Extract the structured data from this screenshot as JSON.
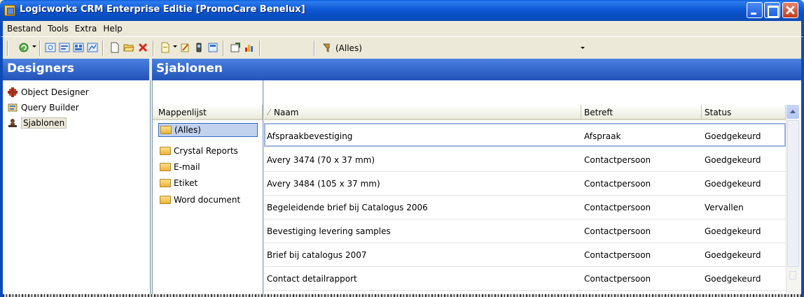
{
  "window": {
    "title": "Logicworks CRM Enterprise Editie  [PromoCare Benelux]"
  },
  "menu": [
    {
      "label": "Bestand"
    },
    {
      "label": "Tools"
    },
    {
      "label": "Extra"
    },
    {
      "label": "Help"
    }
  ],
  "toolbar": {
    "filter_value": "(Alles)",
    "icons": [
      "refresh-icon",
      "search-icon",
      "view-icon",
      "print-view-icon",
      "report-icon",
      "new-document-icon",
      "open-folder-icon",
      "delete-icon",
      "template-icon",
      "edit-icon",
      "mobile-icon",
      "calculator-icon",
      "export-icon",
      "chart-icon",
      "filter-icon"
    ]
  },
  "designers": {
    "header": "Designers",
    "items": [
      {
        "label": "Object Designer"
      },
      {
        "label": "Query Builder"
      },
      {
        "label": "Sjablonen"
      }
    ]
  },
  "sjablonen": {
    "header": "Sjablonen",
    "folder_column": "Mappenlijst",
    "folders": [
      {
        "label": "(Alles)"
      },
      {
        "label": "Crystal Reports"
      },
      {
        "label": "E-mail"
      },
      {
        "label": "Etiket"
      },
      {
        "label": "Word document"
      }
    ],
    "columns": {
      "sort_indicator": "⁄",
      "naam": "Naam",
      "betreft": "Betreft",
      "status": "Status"
    },
    "rows": [
      {
        "naam": "Afspraakbevestiging",
        "betreft": "Afspraak",
        "status": "Goedgekeurd"
      },
      {
        "naam": "Avery 3474 (70 x 37 mm)",
        "betreft": "Contactpersoon",
        "status": "Goedgekeurd"
      },
      {
        "naam": "Avery 3484 (105 x 37 mm)",
        "betreft": "Contactpersoon",
        "status": "Goedgekeurd"
      },
      {
        "naam": "Begeleidende brief bij Catalogus 2006",
        "betreft": "Contactpersoon",
        "status": "Vervallen"
      },
      {
        "naam": "Bevestiging levering samples",
        "betreft": "Contactpersoon",
        "status": "Goedgekeurd"
      },
      {
        "naam": "Brief bij catalogus 2007",
        "betreft": "Contactpersoon",
        "status": "Goedgekeurd"
      },
      {
        "naam": "Contact detailrapport",
        "betreft": "Contactpersoon",
        "status": "Goedgekeurd"
      }
    ]
  },
  "colors": {
    "titlebar": "#0A5FD8",
    "header": "#2253B8",
    "selection": "#C1D2EE"
  }
}
